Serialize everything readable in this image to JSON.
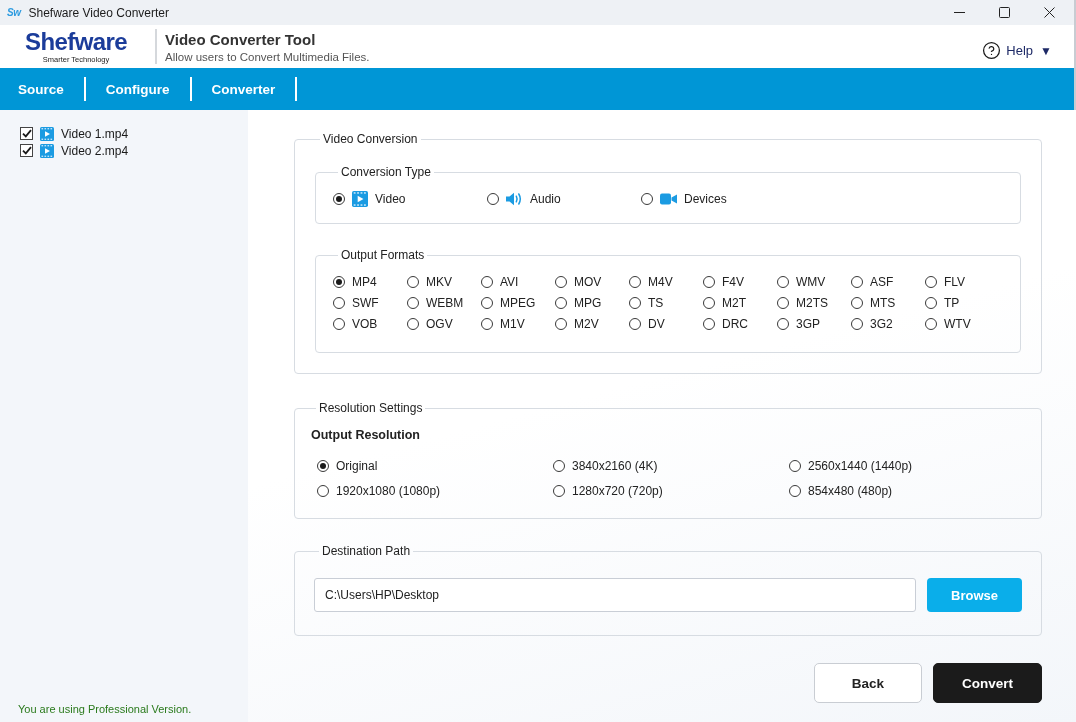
{
  "window": {
    "app_icon": "Sw",
    "title": "Shefware Video Converter"
  },
  "header": {
    "brand": "Shefware",
    "tagline": "Smarter Technology",
    "title": "Video Converter Tool",
    "subtitle": "Allow users to Convert Multimedia Files.",
    "help": {
      "label": "Help",
      "caret": "▼"
    }
  },
  "nav": [
    {
      "label": "Source",
      "selected": false
    },
    {
      "label": "Configure",
      "selected": false
    },
    {
      "label": "Converter",
      "selected": false
    }
  ],
  "sidebar": {
    "files": [
      {
        "name": "Video 1.mp4",
        "checked": true
      },
      {
        "name": "Video 2.mp4",
        "checked": true
      }
    ],
    "footer": "You are using Professional Version."
  },
  "video_conversion": {
    "legend": "Video Conversion",
    "conversion_type": {
      "legend": "Conversion Type",
      "options": [
        {
          "label": "Video",
          "selected": true
        },
        {
          "label": "Audio",
          "selected": false
        },
        {
          "label": "Devices",
          "selected": false
        }
      ]
    },
    "output_formats": {
      "legend": "Output Formats",
      "options": [
        {
          "label": "MP4",
          "selected": true
        },
        {
          "label": "MKV",
          "selected": false
        },
        {
          "label": "AVI",
          "selected": false
        },
        {
          "label": "MOV",
          "selected": false
        },
        {
          "label": "M4V",
          "selected": false
        },
        {
          "label": "F4V",
          "selected": false
        },
        {
          "label": "WMV",
          "selected": false
        },
        {
          "label": "ASF",
          "selected": false
        },
        {
          "label": "FLV",
          "selected": false
        },
        {
          "label": "SWF",
          "selected": false
        },
        {
          "label": "WEBM",
          "selected": false
        },
        {
          "label": "MPEG",
          "selected": false
        },
        {
          "label": "MPG",
          "selected": false
        },
        {
          "label": "TS",
          "selected": false
        },
        {
          "label": "M2T",
          "selected": false
        },
        {
          "label": "M2TS",
          "selected": false
        },
        {
          "label": "MTS",
          "selected": false
        },
        {
          "label": "TP",
          "selected": false
        },
        {
          "label": "VOB",
          "selected": false
        },
        {
          "label": "OGV",
          "selected": false
        },
        {
          "label": "M1V",
          "selected": false
        },
        {
          "label": "M2V",
          "selected": false
        },
        {
          "label": "DV",
          "selected": false
        },
        {
          "label": "DRC",
          "selected": false
        },
        {
          "label": "3GP",
          "selected": false
        },
        {
          "label": "3G2",
          "selected": false
        },
        {
          "label": "WTV",
          "selected": false
        }
      ]
    }
  },
  "resolution_settings": {
    "legend": "Resolution Settings",
    "heading": "Output Resolution",
    "options": [
      {
        "label": "Original",
        "selected": true
      },
      {
        "label": "3840x2160 (4K)",
        "selected": false
      },
      {
        "label": "2560x1440 (1440p)",
        "selected": false
      },
      {
        "label": "1920x1080 (1080p)",
        "selected": false
      },
      {
        "label": "1280x720 (720p)",
        "selected": false
      },
      {
        "label": "854x480 (480p)",
        "selected": false
      }
    ]
  },
  "destination_path": {
    "legend": "Destination Path",
    "value": "C:\\Users\\HP\\Desktop",
    "button": "Browse"
  },
  "actions": [
    {
      "label": "Back",
      "kind": "secondary"
    },
    {
      "label": "Convert",
      "kind": "primary"
    }
  ]
}
